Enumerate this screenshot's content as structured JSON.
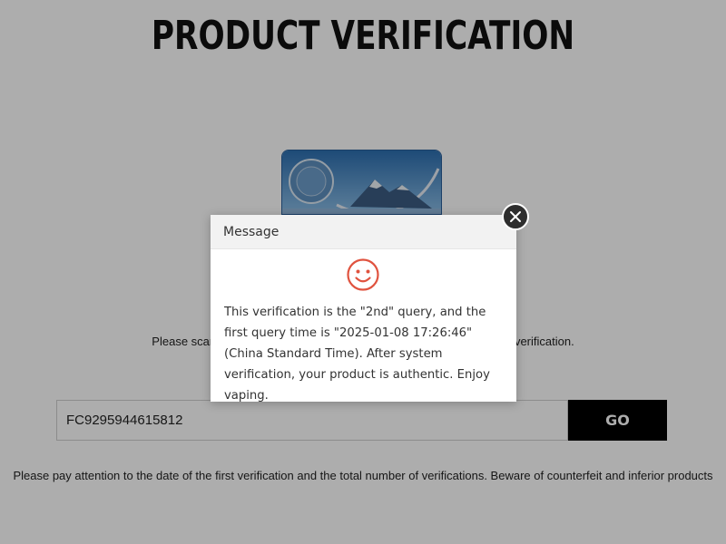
{
  "page": {
    "title": "PRODUCT VERIFICATION",
    "instruction": "Please scan the QR code on the product label and enter the code for verification.",
    "notice": "Please pay attention to the date of the first verification and the total number of verifications. Beware of counterfeit and inferior products"
  },
  "search": {
    "value": "FC9295944615812",
    "go_label": "GO"
  },
  "product_card": {
    "icon": "mountain-card-image"
  },
  "dialog": {
    "title": "Message",
    "icon": "smiley-icon",
    "message": "This verification is the \"2nd\" query, and the first query time is \"2025-01-08 17:26:46\" (China Standard Time). After system verification, your product is authentic. Enjoy vaping.",
    "close_icon": "close-icon"
  },
  "colors": {
    "overlay": "#7a7a7a",
    "smiley": "#e0533f",
    "go_button": "#000000",
    "close_button": "#2e2e2e"
  }
}
